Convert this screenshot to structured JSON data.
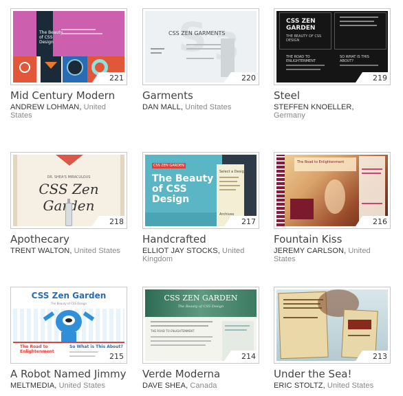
{
  "designs": [
    {
      "number": "221",
      "title": "Mid Century Modern",
      "author": "ANDREW LOHMAN",
      "location": "United States"
    },
    {
      "number": "220",
      "title": "Garments",
      "author": "DAN MALL",
      "location": "United States"
    },
    {
      "number": "219",
      "title": "Steel",
      "author": "STEFFEN KNOELLER",
      "location": "Germany"
    },
    {
      "number": "218",
      "title": "Apothecary",
      "author": "TRENT WALTON",
      "location": "United States"
    },
    {
      "number": "217",
      "title": "Handcrafted",
      "author": "ELLIOT JAY STOCKS",
      "location": "United Kingdom"
    },
    {
      "number": "216",
      "title": "Fountain Kiss",
      "author": "JEREMY CARLSON",
      "location": "United States"
    },
    {
      "number": "215",
      "title": "A Robot Named Jimmy",
      "author": "MELTMEDIA",
      "location": "United States"
    },
    {
      "number": "214",
      "title": "Verde Moderna",
      "author": "DAVE SHEA",
      "location": "Canada"
    },
    {
      "number": "213",
      "title": "Under the Sea!",
      "author": "ERIC STOLTZ",
      "location": "United States"
    }
  ],
  "thumb_text": {
    "t221": "The Beauty of CSS Design",
    "t220": "CSS ZEN GARMENTS",
    "t219_title": "CSS ZEN GARDEN",
    "t219_sub": "THE BEAUTY OF CSS DESIGN",
    "t219_road": "THE ROAD TO ENLIGHTENMENT",
    "t219_about": "SO WHAT IS THIS ABOUT?",
    "t218_small": "DR. SHEA'S MIRACULOUS",
    "t218_title": "CSS Zen Garden",
    "t217_tag": "CSS ZEN GARDEN",
    "t217_title": "The Beauty of CSS Design",
    "t217_select": "Select a Design",
    "t217_archives": "Archives",
    "t216_title": "The Road to Enlightenment",
    "t215_title": "CSS Zen Garden",
    "t215_sub": "The Beauty of CSS Design",
    "t215_road": "The Road to Enlightenment",
    "t215_about": "So What is This About?",
    "t214_title": "CSS ZEN GARDEN",
    "t214_sub": "The Beauty of CSS Design",
    "t214_road": "THE ROAD TO ENLIGHTENMENT"
  }
}
